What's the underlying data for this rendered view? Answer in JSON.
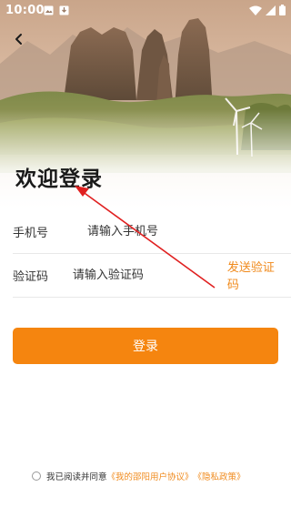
{
  "status_bar": {
    "time": "10:00"
  },
  "header": {
    "back_icon": "back-arrow-icon"
  },
  "page": {
    "title": "欢迎登录"
  },
  "form": {
    "phone_label": "手机号",
    "phone_placeholder": "请输入手机号",
    "code_label": "验证码",
    "code_placeholder": "请输入验证码",
    "send_code_label": "发送验证码"
  },
  "login": {
    "button_label": "登录"
  },
  "agreement": {
    "prefix": "我已阅读并同意",
    "user_agreement": "《我的邵阳用户协议》",
    "privacy_policy": "《隐私政策》"
  },
  "colors": {
    "accent": "#f5850f",
    "link": "#f08a1c",
    "annotation_arrow": "#e02020"
  }
}
